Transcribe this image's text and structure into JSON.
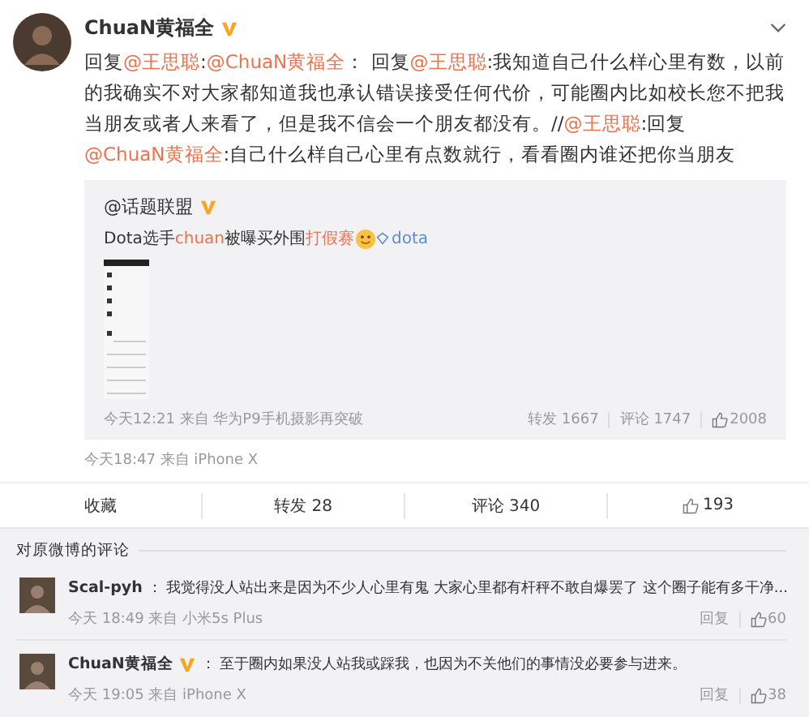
{
  "post": {
    "author": "ChuaN黄福全",
    "verified": true,
    "segments": [
      {
        "kind": "text",
        "text": "回复"
      },
      {
        "kind": "mention",
        "text": "@王思聪"
      },
      {
        "kind": "text",
        "text": ":"
      },
      {
        "kind": "mention",
        "text": "@ChuaN黄福全"
      },
      {
        "kind": "text",
        "text": "： 回复"
      },
      {
        "kind": "mention",
        "text": "@王思聪"
      },
      {
        "kind": "text",
        "text": ":我知道自己什么样心里有数，以前的我确实不对大家都知道我也承认错误接受任何代价，可能圈内比如校长您不把我当朋友或者人来看了，但是我不信会一个朋友都没有。//"
      },
      {
        "kind": "mention",
        "text": "@王思聪"
      },
      {
        "kind": "text",
        "text": ":回复"
      },
      {
        "kind": "mention",
        "text": "@ChuaN黄福全"
      },
      {
        "kind": "text",
        "text": ":自己什么样自己心里有点数就行，看看圈内谁还把你当朋友"
      }
    ],
    "repost": {
      "author": "@话题联盟",
      "verified": true,
      "segments": [
        {
          "kind": "text",
          "text": "Dota选手"
        },
        {
          "kind": "highlight",
          "text": "chuan"
        },
        {
          "kind": "text",
          "text": "被曝买外围"
        },
        {
          "kind": "highlight",
          "text": "打假赛"
        },
        {
          "kind": "emoji"
        },
        {
          "kind": "link",
          "text": "dota"
        }
      ],
      "time": "今天12:21 来自 华为P9手机摄影再突破",
      "reposts": "转发 1667",
      "comments": "评论 1747",
      "likes": "2008"
    },
    "time": "今天18:47 来自 iPhone X",
    "actions": [
      {
        "kind": "text",
        "label": "收藏"
      },
      {
        "kind": "text",
        "label": "转发 28"
      },
      {
        "kind": "text",
        "label": "评论 340"
      },
      {
        "kind": "like",
        "label": "193"
      }
    ]
  },
  "comments_section": {
    "title": "对原微博的评论",
    "comments": [
      {
        "author": "Scal-pyh",
        "verified": false,
        "text": "： 我觉得没人站出来是因为不少人心里有鬼 大家心里都有杆秤不敢自爆罢了 这个圈子能有多干净...",
        "time": "今天 18:49 来自 小米5s Plus",
        "reply": "回复",
        "likes": "60"
      },
      {
        "author": "ChuaN黄福全",
        "verified": true,
        "text": "： 至于圈内如果没人站我或踩我，也因为不关他们的事情没必要参与进来。",
        "time": "今天 19:05 来自 iPhone X",
        "reply": "回复",
        "likes": "38"
      }
    ]
  }
}
